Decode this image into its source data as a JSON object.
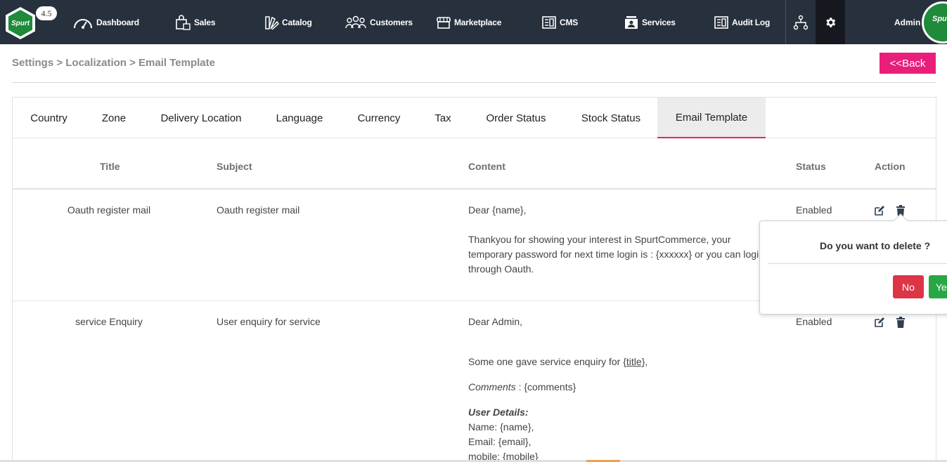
{
  "app": {
    "logo_text": "Spurt",
    "version": "4.5"
  },
  "nav": {
    "items": [
      {
        "label": "Dashboard",
        "icon": "dashboard-gauge-icon"
      },
      {
        "label": "Sales",
        "icon": "shopping-bag-icon"
      },
      {
        "label": "Catalog",
        "icon": "catalog-swatch-icon"
      },
      {
        "label": "Customers",
        "icon": "customers-group-icon"
      },
      {
        "label": "Marketplace",
        "icon": "storefront-icon"
      },
      {
        "label": "CMS",
        "icon": "cms-document-icon"
      },
      {
        "label": "Services",
        "icon": "services-person-icon"
      },
      {
        "label": "Audit Log",
        "icon": "audit-log-icon"
      }
    ],
    "admin_label": "Admin"
  },
  "breadcrumb": "Settings > Localization > Email Template",
  "back_label": "<<Back",
  "tabs": [
    {
      "label": "Country"
    },
    {
      "label": "Zone"
    },
    {
      "label": "Delivery Location"
    },
    {
      "label": "Language"
    },
    {
      "label": "Currency"
    },
    {
      "label": "Tax"
    },
    {
      "label": "Order Status"
    },
    {
      "label": "Stock Status"
    },
    {
      "label": "Email Template",
      "active": true
    }
  ],
  "table": {
    "headers": {
      "title": "Title",
      "subject": "Subject",
      "content": "Content",
      "status": "Status",
      "action": "Action"
    },
    "rows": [
      {
        "title": "Oauth register mail",
        "subject": "Oauth register mail",
        "content_greeting": "Dear {name},",
        "content_line1": "Thankyou for showing your interest in SpurtCommerce, your",
        "content_line2": "temporary password for next time login is : {xxxxxx} or you can login",
        "content_line3": "through Oauth.",
        "status": "Enabled"
      },
      {
        "title": "service Enquiry",
        "subject": "User enquiry for service",
        "content_greeting": "Dear Admin,",
        "content_line1_prefix": "Some one gave service enquiry for ",
        "content_line1_link": "{title}",
        "content_line1_suffix": ",",
        "content_comments_label": "Comments",
        "content_comments_value": " : {comments}",
        "content_user_details": "User Details:",
        "content_name": "Name: {name},",
        "content_email": "Email: {email},",
        "content_mobile": "mobile: {mobile}",
        "status": "Enabled"
      }
    ]
  },
  "delete_popover": {
    "question": "Do you want to delete ?",
    "no_label": "No",
    "yes_label": "Yes"
  },
  "colors": {
    "nav_bg": "#27313d",
    "accent_pink": "#e91e7a",
    "danger": "#dc3545",
    "success": "#28a745"
  }
}
